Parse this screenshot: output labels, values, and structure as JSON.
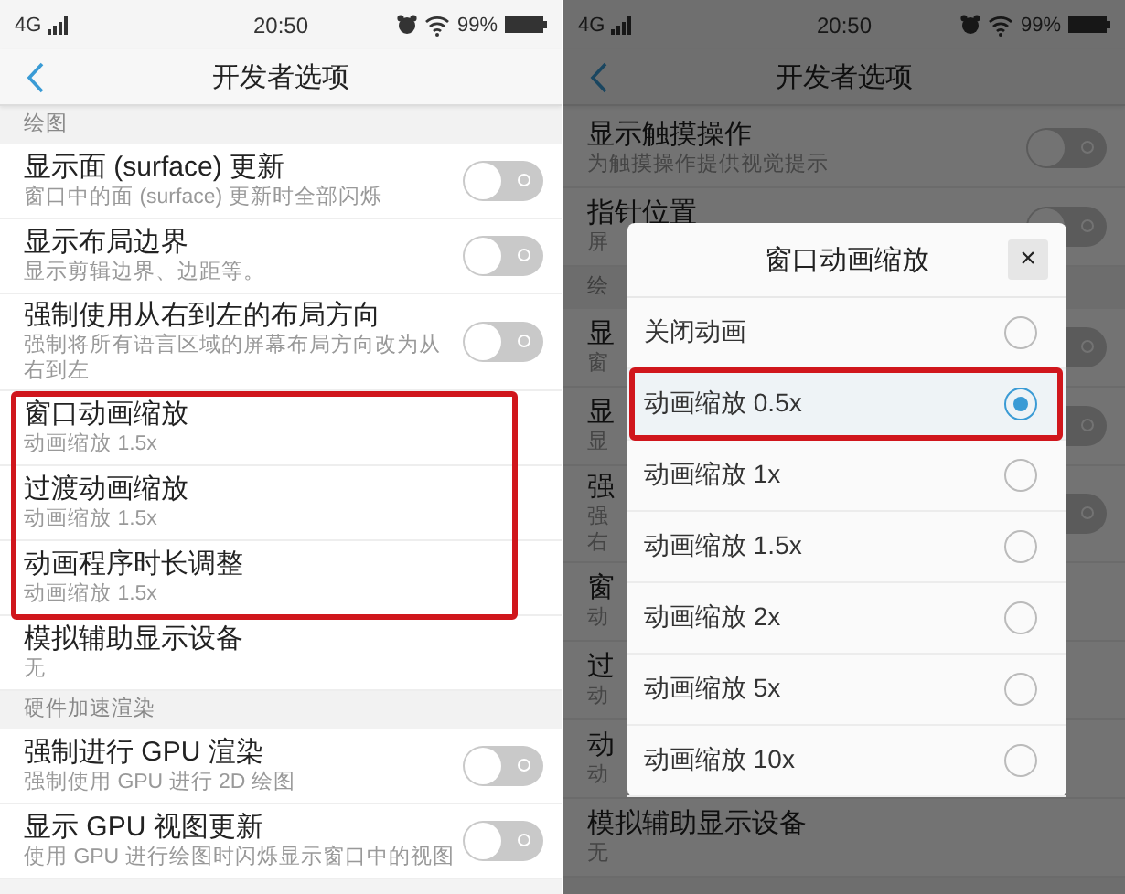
{
  "screens": [
    {
      "status_bar": {
        "network": "4G",
        "time": "20:50",
        "battery": "99%"
      },
      "title": "开发者选项",
      "list": [
        {
          "kind": "section",
          "title": "绘图",
          "highlighted": false
        },
        {
          "kind": "toggle",
          "title": "显示面 (surface) 更新",
          "subtitle": "窗口中的面 (surface) 更新时全部闪烁",
          "on": false,
          "highlighted": false
        },
        {
          "kind": "toggle",
          "title": "显示布局边界",
          "subtitle": "显示剪辑边界、边距等。",
          "on": false,
          "highlighted": false
        },
        {
          "kind": "toggle",
          "title": "强制使用从右到左的布局方向",
          "subtitle": "强制将所有语言区域的屏幕布局方向改为从右到左",
          "on": false,
          "highlighted": false
        },
        {
          "kind": "plain",
          "title": "窗口动画缩放",
          "subtitle": "动画缩放 1.5x",
          "highlighted": true
        },
        {
          "kind": "plain",
          "title": "过渡动画缩放",
          "subtitle": "动画缩放 1.5x",
          "highlighted": true
        },
        {
          "kind": "plain",
          "title": "动画程序时长调整",
          "subtitle": "动画缩放 1.5x",
          "highlighted": true
        },
        {
          "kind": "plain",
          "title": "模拟辅助显示设备",
          "subtitle": "无",
          "highlighted": false
        },
        {
          "kind": "section",
          "title": "硬件加速渲染",
          "highlighted": false
        },
        {
          "kind": "toggle",
          "title": "强制进行 GPU 渲染",
          "subtitle": "强制使用 GPU 进行 2D 绘图",
          "on": false,
          "highlighted": false
        },
        {
          "kind": "toggle",
          "title": "显示 GPU 视图更新",
          "subtitle": "使用 GPU 进行绘图时闪烁显示窗口中的视图",
          "on": false,
          "highlighted": false
        }
      ]
    },
    {
      "status_bar": {
        "network": "4G",
        "time": "20:50",
        "battery": "99%"
      },
      "title": "开发者选项",
      "list": [
        {
          "kind": "toggle",
          "title": "显示触摸操作",
          "subtitle": "为触摸操作提供视觉提示",
          "on": false
        },
        {
          "kind": "toggle",
          "title": "指针位置",
          "subtitle": "屏",
          "on": false
        },
        {
          "kind": "section",
          "title": "绘"
        },
        {
          "kind": "toggle",
          "title": "显",
          "subtitle": "窗",
          "on": false
        },
        {
          "kind": "toggle",
          "title": "显",
          "subtitle": "显",
          "on": false
        },
        {
          "kind": "toggle",
          "title": "强",
          "subtitle": [
            "强",
            "右"
          ],
          "on": false
        },
        {
          "kind": "plain",
          "title": "窗",
          "subtitle": "动"
        },
        {
          "kind": "plain",
          "title": "过",
          "subtitle": "动"
        },
        {
          "kind": "plain",
          "title": "动",
          "subtitle": "动"
        },
        {
          "kind": "plain",
          "title": "模拟辅助显示设备",
          "subtitle": "无"
        }
      ],
      "dialog": {
        "title": "窗口动画缩放",
        "close": "×",
        "options": [
          {
            "label": "关闭动画",
            "selected": false,
            "highlighted": false
          },
          {
            "label": "动画缩放 0.5x",
            "selected": true,
            "highlighted": true
          },
          {
            "label": "动画缩放 1x",
            "selected": false,
            "highlighted": false
          },
          {
            "label": "动画缩放 1.5x",
            "selected": false,
            "highlighted": false
          },
          {
            "label": "动画缩放 2x",
            "selected": false,
            "highlighted": false
          },
          {
            "label": "动画缩放 5x",
            "selected": false,
            "highlighted": false
          },
          {
            "label": "动画缩放 10x",
            "selected": false,
            "highlighted": false
          }
        ]
      }
    }
  ]
}
